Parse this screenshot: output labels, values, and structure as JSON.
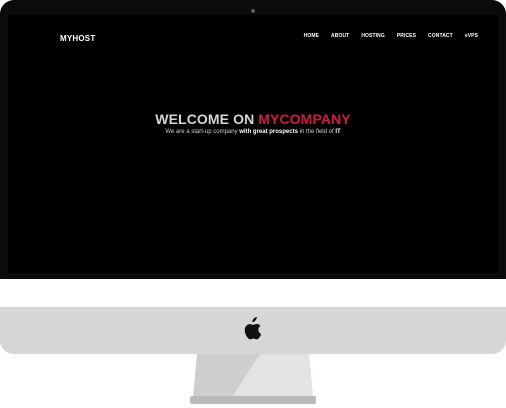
{
  "site": {
    "brand": "MYHOST",
    "nav": [
      {
        "label": "HOME"
      },
      {
        "label": "ABOUT"
      },
      {
        "label": "HOSTING"
      },
      {
        "label": "PRICES"
      },
      {
        "label": "CONTACT"
      },
      {
        "label": "eVPS"
      }
    ]
  },
  "hero": {
    "title_prefix": "WELCOME ON ",
    "title_accent": "MYCOMPANY",
    "subtitle_part1": "We are a start-up company ",
    "subtitle_bold1": "with great prospects",
    "subtitle_part2": " in the field of ",
    "subtitle_bold2": "IT"
  },
  "colors": {
    "screen_bg": "#000000",
    "accent": "#d11c47",
    "monitor_grey": "#d5d6d7",
    "bezel": "#0b0b0b"
  },
  "icons": {
    "logo": "apple-logo-icon",
    "camera": "camera-icon"
  }
}
